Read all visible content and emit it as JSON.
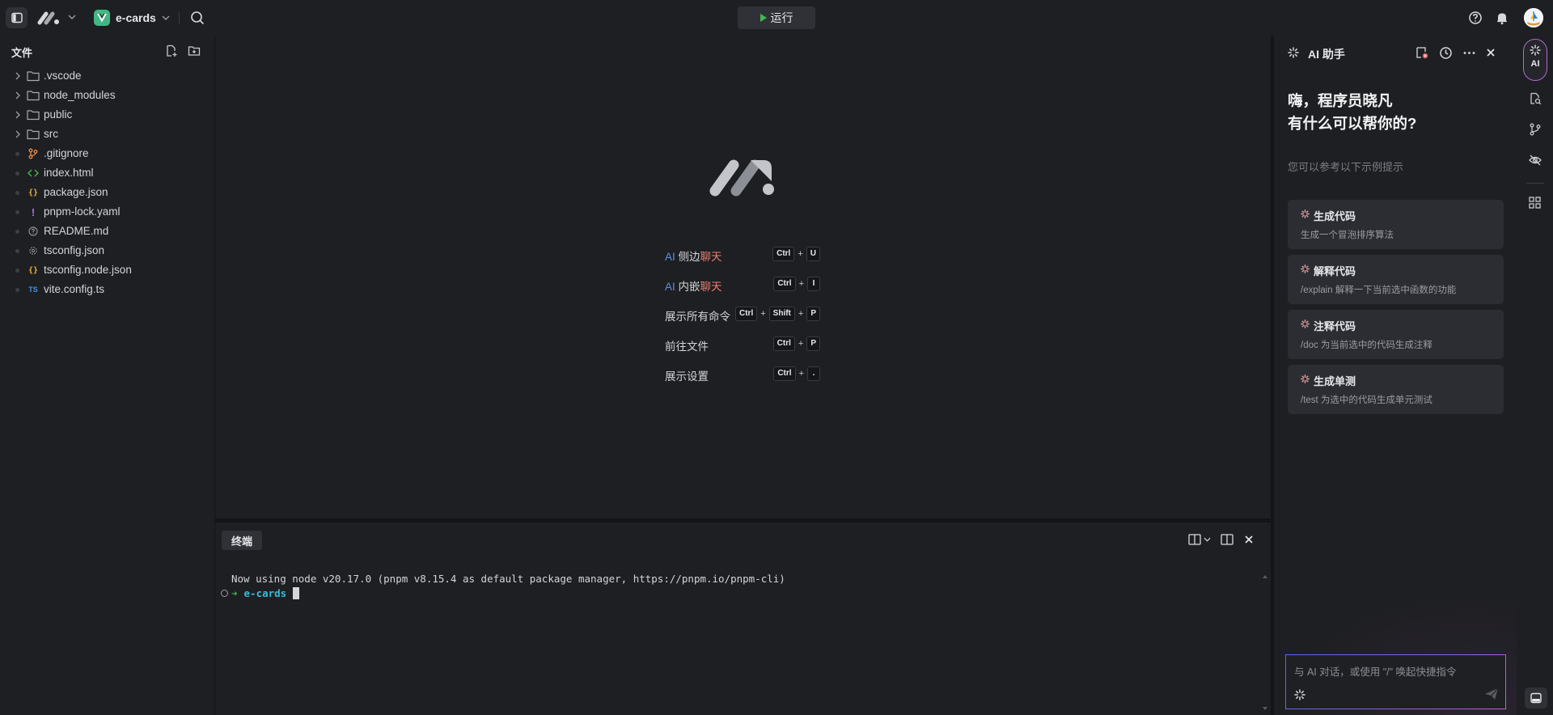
{
  "topbar": {
    "project_name": "e-cards",
    "run_label": "运行"
  },
  "sidebar": {
    "header": "文件",
    "items": [
      {
        "name": ".vscode",
        "type": "folder"
      },
      {
        "name": "node_modules",
        "type": "folder"
      },
      {
        "name": "public",
        "type": "folder"
      },
      {
        "name": "src",
        "type": "folder"
      },
      {
        "name": ".gitignore",
        "type": "git"
      },
      {
        "name": "index.html",
        "type": "html"
      },
      {
        "name": "package.json",
        "type": "json"
      },
      {
        "name": "pnpm-lock.yaml",
        "type": "yaml"
      },
      {
        "name": "README.md",
        "type": "md"
      },
      {
        "name": "tsconfig.json",
        "type": "tsconfig"
      },
      {
        "name": "tsconfig.node.json",
        "type": "json"
      },
      {
        "name": "vite.config.ts",
        "type": "ts"
      }
    ]
  },
  "welcome": {
    "shortcuts": [
      {
        "label_prefix": "AI",
        "label_mid": " 侧边",
        "label_suffix": "聊天",
        "keys": [
          "Ctrl",
          "U"
        ]
      },
      {
        "label_prefix": "AI",
        "label_mid": " 内嵌",
        "label_suffix": "聊天",
        "keys": [
          "Ctrl",
          "I"
        ]
      },
      {
        "label": "展示所有命令",
        "keys": [
          "Ctrl",
          "Shift",
          "P"
        ]
      },
      {
        "label": "前往文件",
        "keys": [
          "Ctrl",
          "P"
        ]
      },
      {
        "label": "展示设置",
        "keys": [
          "Ctrl",
          "."
        ]
      }
    ]
  },
  "terminal": {
    "tab_label": "终端",
    "output_line": "Now using node v20.17.0 (pnpm v8.15.4 as default package manager, https://pnpm.io/pnpm-cli)",
    "prompt_dir": "e-cards"
  },
  "ai_panel": {
    "title": "AI 助手",
    "greeting_line1": "嗨，程序员晓凡",
    "greeting_line2": "有什么可以帮你的?",
    "hint": "您可以参考以下示例提示",
    "cards": [
      {
        "title": "生成代码",
        "desc": "生成一个冒泡排序算法"
      },
      {
        "title": "解释代码",
        "desc": "/explain 解释一下当前选中函数的功能"
      },
      {
        "title": "注释代码",
        "desc": "/doc 为当前选中的代码生成注释"
      },
      {
        "title": "生成单测",
        "desc": "/test 为选中的代码生成单元测试"
      }
    ],
    "input_placeholder": "与 AI 对话，或使用 \"/\" 唤起快捷指令"
  },
  "rail": {
    "ai_label": "AI"
  },
  "colors": {
    "background": "#1e1f22",
    "accent_green": "#3fb950",
    "accent_vue": "#41b883",
    "ai_blue": "#5e8ee8",
    "chat_red": "#e67e73",
    "terminal_dir": "#38bdd8"
  }
}
